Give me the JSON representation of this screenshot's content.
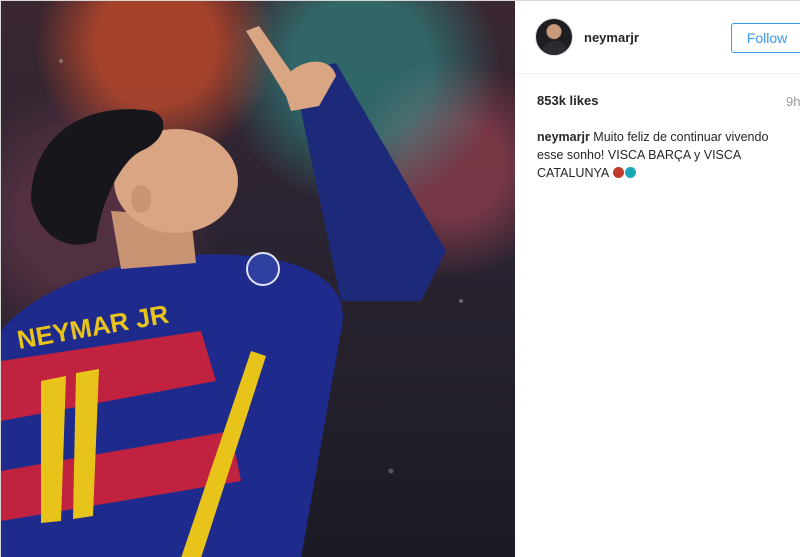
{
  "post": {
    "username": "neymarjr",
    "follow_label": "Follow",
    "likes": "853k likes",
    "time": "9h",
    "caption": {
      "username": "neymarjr",
      "text": "Muito feliz de continuar vivendo esse sonho! VISCA BARÇA y VISCA CATALUNYA"
    },
    "emoji_dots": [
      "#c0392b",
      "#1aa8b8"
    ]
  },
  "photo": {
    "jersey_name": "NEYMAR JR",
    "jersey_number": "11"
  }
}
